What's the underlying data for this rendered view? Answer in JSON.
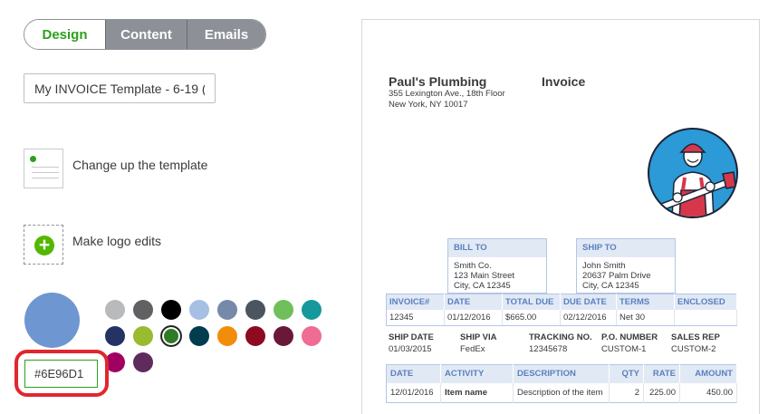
{
  "tabs": [
    {
      "label": "Design",
      "active": true
    },
    {
      "label": "Content",
      "active": false
    },
    {
      "label": "Emails",
      "active": false
    }
  ],
  "template_name": {
    "value": "My INVOICE Template - 6-19 ("
  },
  "options": {
    "change_template": "Change up the template",
    "logo_edits": "Make logo edits"
  },
  "colors": {
    "selected": "#6E96D1",
    "selected_swatch": "#6e96d1",
    "palette": [
      "#b9babc",
      "#616163",
      "#000000",
      "#a6bfe3",
      "#748aa8",
      "#4b5560",
      "#6fbf5a",
      "#17989a",
      "#243363",
      "#99bb2f",
      "#2f7a26",
      "#023d4e",
      "#f28d09",
      "#8d0a21",
      "#6a1839",
      "#ef6c94",
      "#a10063",
      "#5e2b5c"
    ],
    "selected_index": 10,
    "highlight_ring": "#e0272e",
    "brand_green": "#2ca01c"
  },
  "invoice": {
    "company": "Paul's Plumbing",
    "address_line1": "355 Lexington Ave., 18th Floor",
    "address_line2": "New York, NY 10017",
    "title": "Invoice",
    "bill_to": {
      "label": "BILL TO",
      "l1": "Smith Co.",
      "l2": "123 Main Street",
      "l3": "City, CA 12345"
    },
    "ship_to": {
      "label": "SHIP TO",
      "l1": "John Smith",
      "l2": "20637 Palm Drive",
      "l3": "City, CA 12345"
    },
    "summary_headers": [
      "INVOICE#",
      "DATE",
      "TOTAL DUE",
      "DUE DATE",
      "TERMS",
      "ENCLOSED"
    ],
    "summary_values": [
      "12345",
      "01/12/2016",
      "$665.00",
      "02/12/2016",
      "Net 30",
      ""
    ],
    "ship_info": [
      {
        "label": "SHIP DATE",
        "value": "01/03/2015"
      },
      {
        "label": "SHIP VIA",
        "value": "FedEx"
      },
      {
        "label": "TRACKING NO.",
        "value": "12345678"
      },
      {
        "label": "P.O. NUMBER",
        "value": "CUSTOM-1"
      },
      {
        "label": "SALES REP",
        "value": "CUSTOM-2"
      }
    ],
    "item_headers": [
      "DATE",
      "ACTIVITY",
      "DESCRIPTION",
      "QTY",
      "RATE",
      "AMOUNT"
    ],
    "items": [
      {
        "date": "12/01/2016",
        "activity": "Item name",
        "description": "Description of the item",
        "qty": "2",
        "rate": "225.00",
        "amount": "450.00"
      }
    ],
    "logo_icon": "plumber-logo-icon"
  }
}
